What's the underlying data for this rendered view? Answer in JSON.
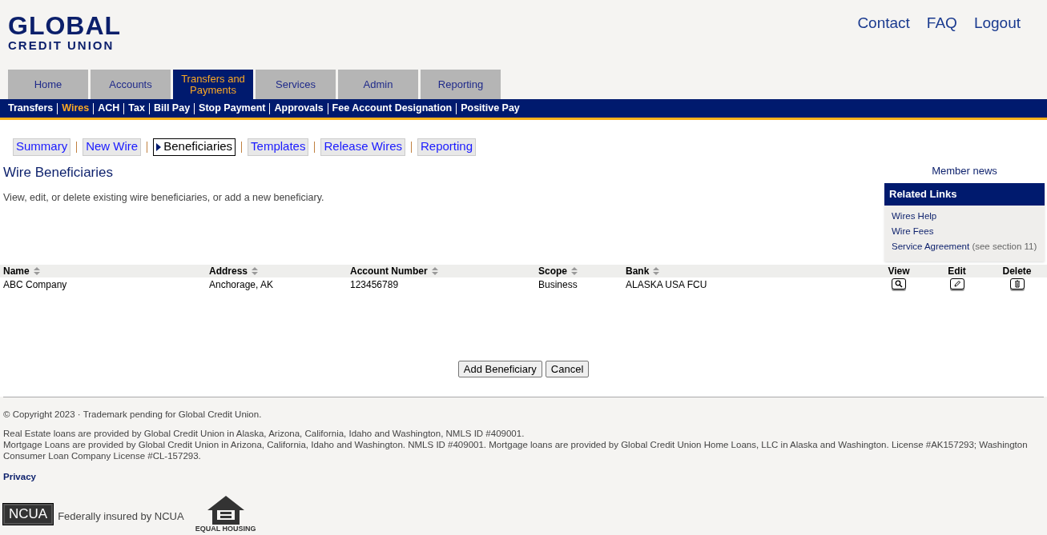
{
  "logo": {
    "line1": "GLOBAL",
    "line2": "CREDIT UNION"
  },
  "top_links": [
    "Contact",
    "FAQ",
    "Logout"
  ],
  "main_tabs": [
    {
      "label": "Home",
      "selected": false
    },
    {
      "label": "Accounts",
      "selected": false
    },
    {
      "label": "Transfers and Payments",
      "selected": true
    },
    {
      "label": "Services",
      "selected": false
    },
    {
      "label": "Admin",
      "selected": false
    },
    {
      "label": "Reporting",
      "selected": false
    }
  ],
  "sub_nav": [
    {
      "label": "Transfers",
      "selected": false
    },
    {
      "label": "Wires",
      "selected": true
    },
    {
      "label": "ACH",
      "selected": false
    },
    {
      "label": "Tax",
      "selected": false
    },
    {
      "label": "Bill Pay",
      "selected": false
    },
    {
      "label": "Stop Payment",
      "selected": false
    },
    {
      "label": "Approvals",
      "selected": false
    },
    {
      "label": "Fee Account Designation",
      "selected": false
    },
    {
      "label": "Positive Pay",
      "selected": false
    }
  ],
  "wire_tabs": [
    {
      "label": "Summary",
      "selected": false
    },
    {
      "label": "New Wire",
      "selected": false
    },
    {
      "label": "Beneficiaries",
      "selected": true
    },
    {
      "label": "Templates",
      "selected": false
    },
    {
      "label": "Release Wires",
      "selected": false
    },
    {
      "label": "Reporting",
      "selected": false
    }
  ],
  "page": {
    "title": "Wire Beneficiaries",
    "description": "View, edit, or delete existing wire beneficiaries, or add a new beneficiary."
  },
  "sidebar": {
    "member_news": "Member news",
    "related_links_title": "Related Links",
    "links": [
      {
        "label": "Wires Help"
      },
      {
        "label": "Wire Fees"
      },
      {
        "label": "Service Agreement",
        "note": "(see section 11)"
      }
    ]
  },
  "table": {
    "columns": [
      "Name",
      "Address",
      "Account Number",
      "Scope",
      "Bank"
    ],
    "action_columns": [
      {
        "label": "View",
        "kind": "view"
      },
      {
        "label": "Edit",
        "kind": "edit"
      },
      {
        "label": "Delete",
        "kind": "delete"
      }
    ],
    "rows": [
      {
        "cells": [
          "ABC Company",
          "Anchorage, AK",
          "123456789",
          "Business",
          "ALASKA USA FCU"
        ]
      }
    ]
  },
  "buttons": [
    "Add Beneficiary",
    "Cancel"
  ],
  "footer": {
    "copyright": "© Copyright 2023 · Trademark pending for Global Credit Union.",
    "legal": [
      "Real Estate loans are provided by Global Credit Union in Alaska, Arizona, California, Idaho and Washington, NMLS ID #409001.",
      "Mortgage Loans are provided by Global Credit Union in Arizona, California, Idaho and Washington. NMLS ID #409001. Mortgage loans are provided by Global Credit Union Home Loans, LLC in Alaska and Washington. License #AK157293; Washington Consumer Loan Company License #CL-157293."
    ],
    "privacy": "Privacy",
    "ncua_badge": "NCUA",
    "ncua_text": "Federally insured by NCUA",
    "ehl_text": "EQUAL HOUSING"
  }
}
